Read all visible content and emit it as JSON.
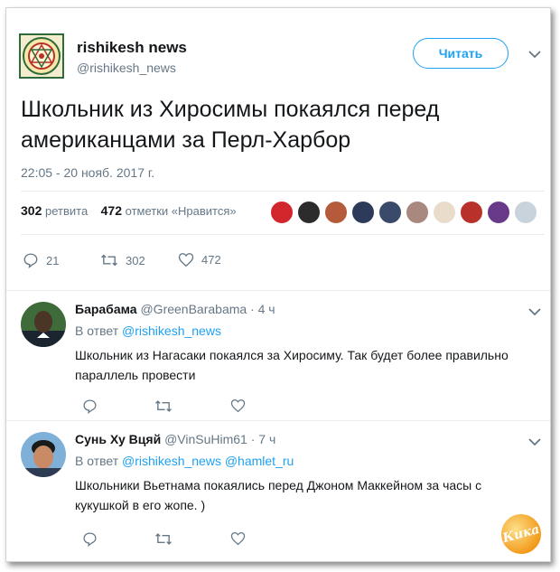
{
  "tweet": {
    "author_name": "rishikesh news",
    "author_handle": "@rishikesh_news",
    "follow_label": "Читать",
    "text": "Школьник из Хиросимы покаялся перед американцами за Перл-Харбор",
    "timestamp": "22:05 - 20 нояб. 2017 г.",
    "retweets_count": "302",
    "retweets_label": "ретвита",
    "likes_count": "472",
    "likes_label": "отметки «Нравится»",
    "liker_avatars": [
      "avatar-1",
      "avatar-2",
      "avatar-3",
      "avatar-4",
      "avatar-5",
      "avatar-6",
      "avatar-7",
      "avatar-8",
      "avatar-9"
    ],
    "actions": {
      "replies": "21",
      "retweets": "302",
      "likes": "472"
    }
  },
  "replies": [
    {
      "name": "Барабама",
      "handle": "@GreenBarabama",
      "age": "· 4 ч",
      "reply_to_label": "В ответ",
      "reply_to": [
        "@rishikesh_news"
      ],
      "text": "Школьник из Нагасаки покаялся за Хиросиму. Так будет более правильно параллель провести"
    },
    {
      "name": "Сунь Ху Вцяй",
      "handle": "@VinSuHim61",
      "age": "· 7 ч",
      "reply_to_label": "В ответ",
      "reply_to": [
        "@rishikesh_news",
        "@hamlet_ru"
      ],
      "text": "Школьники Вьетнама покаялись перед Джоном Маккейном за часы с кукушкой в его жопе. )"
    }
  ],
  "watermark": "Кика",
  "colors": {
    "accent": "#1da1f2",
    "text": "#14171a",
    "muted": "#657786",
    "divider": "#e6ecf0"
  }
}
